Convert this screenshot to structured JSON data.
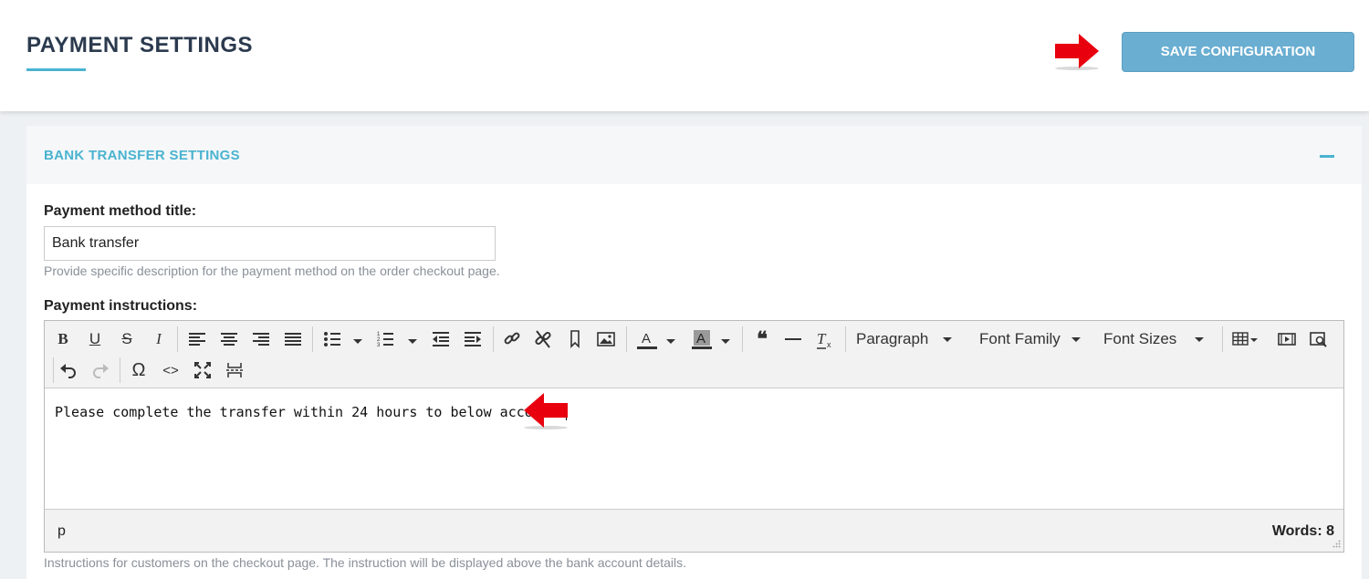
{
  "header": {
    "title": "PAYMENT SETTINGS",
    "save_label": "SAVE CONFIGURATION"
  },
  "section": {
    "title": "BANK TRANSFER SETTINGS"
  },
  "fields": {
    "title_label": "Payment method title:",
    "title_value": "Bank transfer",
    "title_help": "Provide specific description for the payment method on the order checkout page.",
    "instructions_label": "Payment instructions:",
    "instructions_help": "Instructions for customers on the checkout page. The instruction will be displayed above the bank account details."
  },
  "editor": {
    "format_select": "Paragraph",
    "font_family_select": "Font Family",
    "font_size_select": "Font Sizes",
    "content": "Please complete the transfer within 24 hours to below account:",
    "status_path": "p",
    "word_count": "Words: 8"
  },
  "colors": {
    "accent": "#4ab3cf",
    "save_button": "#6aaed2",
    "title": "#2b3a4e",
    "arrow": "#e8000f"
  }
}
